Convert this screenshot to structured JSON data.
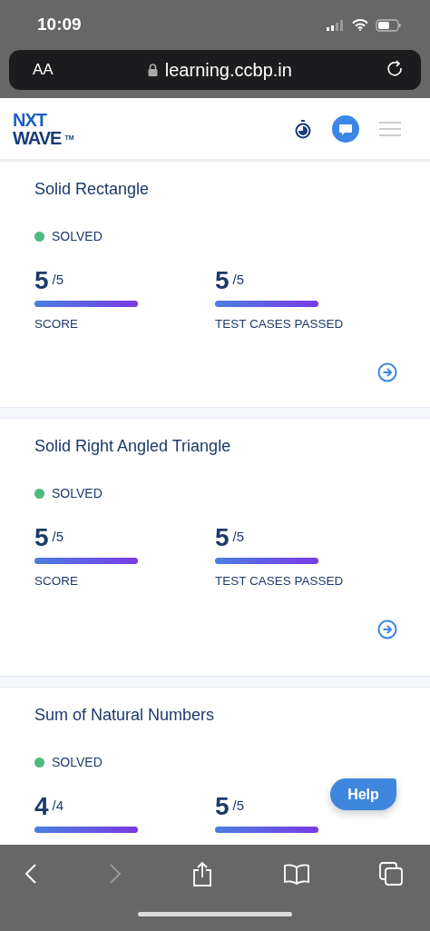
{
  "status_bar": {
    "time": "10:09"
  },
  "browser": {
    "text_size": "AA",
    "url": "learning.ccbp.in"
  },
  "header": {
    "logo_top": "NXT",
    "logo_bottom": "WAVE",
    "logo_mark": "TM"
  },
  "problems": [
    {
      "title": "Solid Rectangle",
      "status": "SOLVED",
      "color": "#4cbb7f",
      "metrics": [
        {
          "value": "5",
          "total": "/5",
          "level": 1,
          "label": "SCORE"
        },
        {
          "value": "5",
          "total": "/5",
          "level": 1,
          "label": "TEST CASES PASSED"
        }
      ]
    },
    {
      "title": "Solid Right Angled Triangle",
      "status": "SOLVED",
      "color": "#4cbb7f",
      "metrics": [
        {
          "value": "5",
          "total": "/5",
          "level": 1,
          "label": "SCORE"
        },
        {
          "value": "5",
          "total": "/5",
          "level": 1,
          "label": "TEST CASES PASSED"
        }
      ]
    },
    {
      "title": "Sum of Natural Numbers",
      "status": "SOLVED",
      "color": "#4cbb7f",
      "metrics": [
        {
          "value": "4",
          "total": "/4",
          "level": 1
        },
        {
          "value": "5",
          "total": "/5",
          "level": 1
        }
      ]
    }
  ],
  "help_button": "Help"
}
